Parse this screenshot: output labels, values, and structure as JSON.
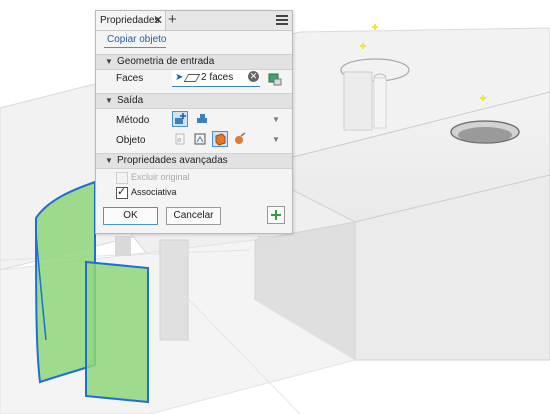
{
  "panel": {
    "tab_label": "Propriedades",
    "tab_close": "✕",
    "tab_add": "+",
    "copy_link": "Copiar objeto",
    "sections": {
      "input_geometry": "Geometria de entrada",
      "output": "Saída",
      "advanced": "Propriedades avançadas"
    },
    "faces_label": "Faces",
    "faces_value": "2 faces",
    "method_label": "Método",
    "object_label": "Objeto",
    "exclude_original": "Excluir original",
    "exclude_original_checked": false,
    "associative": "Associativa",
    "associative_checked": true,
    "ok": "OK",
    "cancel": "Cancelar"
  },
  "icons": {
    "menu": "hamburger-menu-icon",
    "cursor": "select-arrow-icon",
    "face": "face-icon",
    "clear": "clear-selection-icon",
    "color": "color-override-icon",
    "method_new": "new-body-icon",
    "method_surface": "surface-body-icon",
    "object_surface": "surface-object-icon",
    "object_composite": "composite-object-icon",
    "object_solid": "solid-body-icon",
    "object_repair": "repair-body-icon",
    "apply": "apply-plus-icon"
  },
  "colors": {
    "accent": "#3b82c4",
    "highlight_face": "#8fd67a",
    "highlight_edge": "#1f6fd0",
    "apply_green": "#2ea043",
    "work_point": "#f0e63a"
  }
}
